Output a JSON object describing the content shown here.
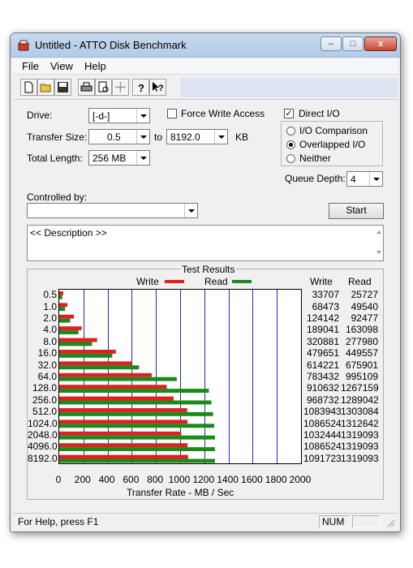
{
  "window": {
    "title": "Untitled - ATTO Disk Benchmark",
    "min_glyph": "–",
    "max_glyph": "□",
    "close_glyph": "x"
  },
  "menu": [
    "File",
    "View",
    "Help"
  ],
  "toolbar_icons": [
    "new-file-icon",
    "open-folder-icon",
    "save-icon",
    "print-icon",
    "print-preview-icon",
    "move-icon",
    "help-icon",
    "context-help-icon"
  ],
  "form": {
    "drive_label": "Drive:",
    "drive_value": "[-d-]",
    "force_write_label": "Force Write Access",
    "force_write_checked": false,
    "direct_io_label": "Direct I/O",
    "direct_io_checked": true,
    "transfer_size_label": "Transfer Size:",
    "transfer_from": "0.5",
    "to_label": "to",
    "transfer_to": "8192.0",
    "kb_label": "KB",
    "total_length_label": "Total Length:",
    "total_length_value": "256 MB",
    "io_options": [
      {
        "label": "I/O Comparison",
        "selected": false
      },
      {
        "label": "Overlapped I/O",
        "selected": true
      },
      {
        "label": "Neither",
        "selected": false
      }
    ],
    "queue_depth_label": "Queue Depth:",
    "queue_depth_value": "4",
    "controlled_by_label": "Controlled by:",
    "controlled_by_value": "",
    "start_label": "Start",
    "description": "<< Description >>"
  },
  "results": {
    "group_label": "Test Results",
    "legend_write": "Write",
    "legend_read": "Read",
    "col_write": "Write",
    "col_read": "Read",
    "write_values": [
      "33707",
      "68473",
      "124142",
      "189041",
      "320881",
      "479651",
      "614221",
      "783432",
      "910632",
      "968732",
      "1083943",
      "1086524",
      "1032444",
      "1086524",
      "1091723"
    ],
    "read_values": [
      "25727",
      "49540",
      "92477",
      "163098",
      "277980",
      "449557",
      "675901",
      "995109",
      "1267159",
      "1289042",
      "1303084",
      "1312642",
      "1319093",
      "1319093",
      "1319093"
    ]
  },
  "chart_data": {
    "type": "bar",
    "orientation": "horizontal",
    "categories": [
      "0.5",
      "1.0",
      "2.0",
      "4.0",
      "8.0",
      "16.0",
      "32.0",
      "64.0",
      "128.0",
      "256.0",
      "512.0",
      "1024.0",
      "2048.0",
      "4096.0",
      "8192.0"
    ],
    "series": [
      {
        "name": "Write",
        "color": "#e02020",
        "values": [
          32.9,
          66.9,
          121.2,
          184.6,
          313.4,
          468.4,
          599.8,
          765.1,
          889.3,
          946.0,
          1058.5,
          1061.1,
          1008.2,
          1061.1,
          1066.1
        ]
      },
      {
        "name": "Read",
        "color": "#1a8a1a",
        "values": [
          25.1,
          48.4,
          90.3,
          159.3,
          271.5,
          439.0,
          660.1,
          971.8,
          1237.5,
          1258.8,
          1272.5,
          1281.9,
          1288.2,
          1288.2,
          1288.2
        ]
      }
    ],
    "xlim": [
      0,
      2000
    ],
    "xticks": [
      "0",
      "200",
      "400",
      "600",
      "800",
      "1000",
      "1200",
      "1400",
      "1600",
      "1800",
      "2000"
    ],
    "xlabel": "Transfer Rate - MB / Sec",
    "grid": "vertical"
  },
  "status": {
    "help_text": "For Help, press F1",
    "num": "NUM"
  }
}
